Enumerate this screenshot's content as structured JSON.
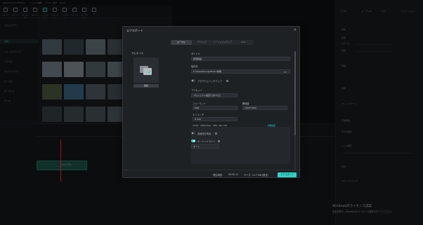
{
  "app": {
    "title": "Wondershare Filmora",
    "menu": [
      "ファイル",
      "編集",
      "ツール",
      "表示",
      "ヘルプ"
    ]
  },
  "toolbar": {
    "items": [
      "メディア",
      "ストック",
      "オーディオ",
      "タイトル",
      "トランジション",
      "エフェクト",
      "フィルター",
      "ステッカー",
      "テンプレート",
      "AI"
    ]
  },
  "sidebar": {
    "items": [
      "プロジェクト",
      "共有",
      "ストックメディア",
      "クラウド",
      "マイライブラリ",
      "ローカル",
      "オーディオ",
      "テーマ"
    ]
  },
  "dialog": {
    "title": "エクスポート",
    "close": "✕",
    "tabs": [
      "ローカル",
      "デバイス",
      "ソーシャルメディア",
      "DVD"
    ],
    "thumbnail_label": "サムネイル",
    "edit_button": "編集",
    "name_label": "タイトル",
    "name_value": "新規録画",
    "save_to_label": "保存先",
    "save_to_value": "C:/Users/wondy/Music/新規",
    "share_cloud_label": "クラウドにバックアップ",
    "preset_label": "プリセット",
    "preset_value": "プロジェクト設定に合わせる",
    "format_label": "フォーマット",
    "format_value": "MP4",
    "resolution_label": "解像度",
    "resolution_value": "1920*1080",
    "encoder_label": "エンコーダ",
    "encoder_value": "H.264",
    "bitrate_label": "ビットレート",
    "bitrate_info": "30 fps　8000 Kbps　SDR - Rec.709",
    "advanced_link": "詳細設定",
    "gpu_label": "高速化を有効",
    "auto_highlight_label": "オートハイライト",
    "auto_highlight_value": "オート",
    "duration_label": "再生時間：",
    "duration_value": "00:00:11",
    "size_label": "サイズ：",
    "size_value": "12.7 MB (推定)",
    "export_button": "エクスポート"
  },
  "right_panel": {
    "tabs": [
      "ビデオ",
      "オーディオ",
      "カラー",
      "アニメーション"
    ],
    "labels": [
      "基本",
      "変形",
      "スケール",
      "位置",
      "回転",
      "合成",
      "ブレンドモード",
      "不透明度",
      "手ぶれ補正",
      "レンズ補正",
      "背景",
      "ドロップシャドウ"
    ]
  },
  "windows": {
    "activate_title": "Windowsのライセンス認証",
    "activate_desc": "設定を開き、Windowsのライセンス認証を行ってください。"
  },
  "timeline": {
    "clip_label": "マイビデオ"
  },
  "colors": {
    "accent": "#2fd3c7",
    "clip": "#1d5a4e",
    "playhead": "#e04444"
  }
}
